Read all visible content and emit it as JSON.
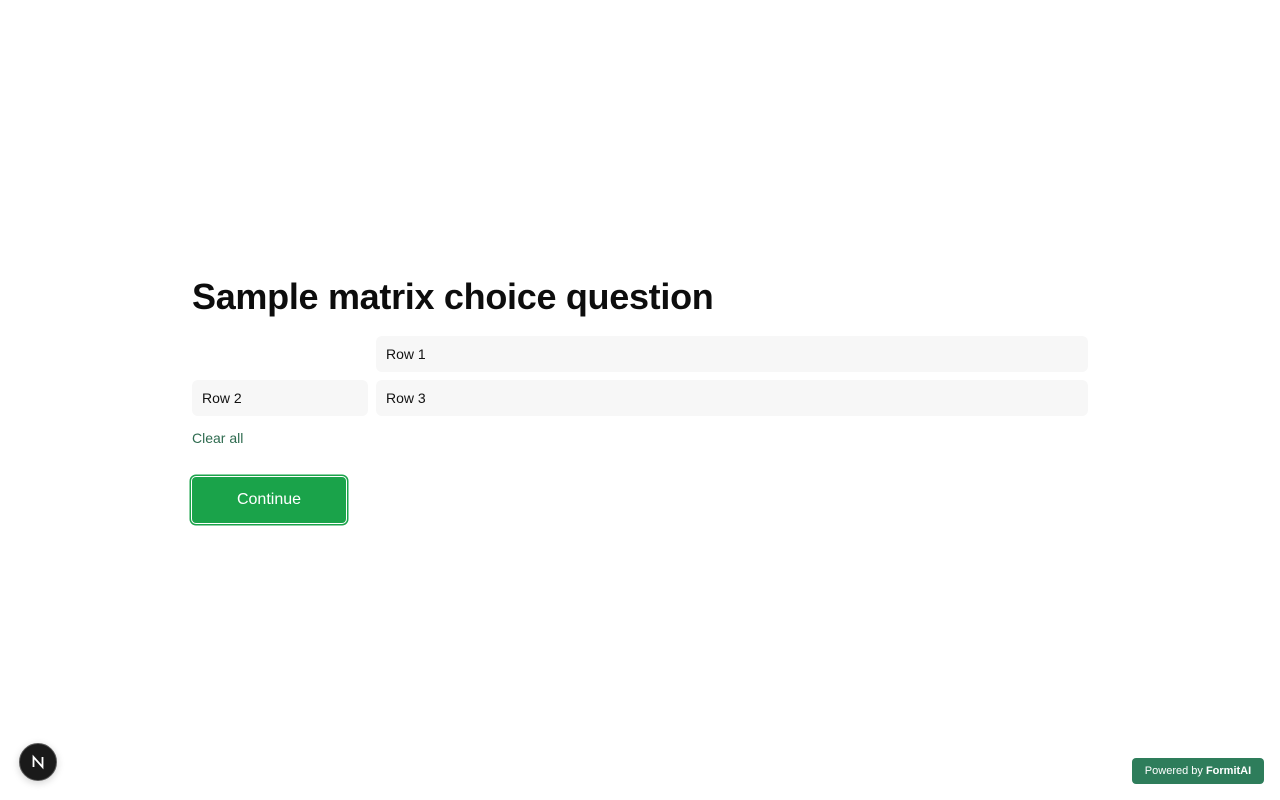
{
  "question": {
    "title": "Sample matrix choice question"
  },
  "matrix": {
    "rows": [
      "Row 1",
      "Row 2",
      "Row 3"
    ]
  },
  "actions": {
    "clear_all_label": "Clear all",
    "continue_label": "Continue"
  },
  "footer": {
    "next_badge_letter": "N",
    "powered_by_prefix": "Powered by",
    "powered_by_brand": "FormitAI"
  },
  "colors": {
    "accent": "#1aa34a",
    "link": "#2e6b4f",
    "badge_bg": "#2e7d5b",
    "cell_bg": "#f7f7f7"
  }
}
